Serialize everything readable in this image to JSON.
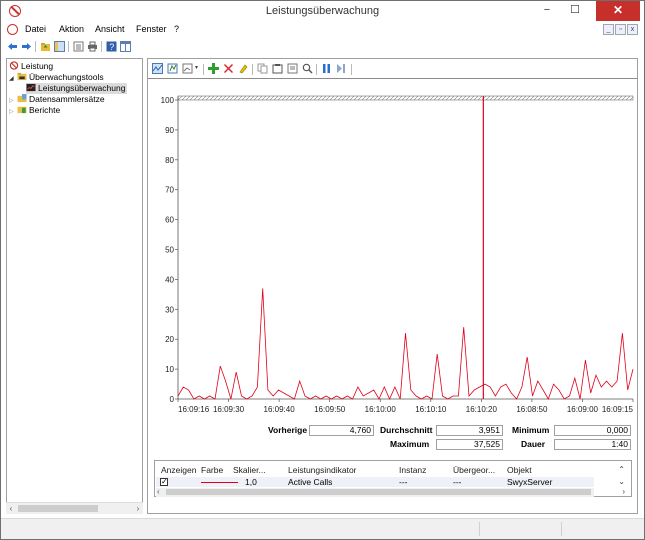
{
  "window": {
    "title": "Leistungsüberwachung"
  },
  "menubar": {
    "items": [
      "Datei",
      "Aktion",
      "Ansicht",
      "Fenster",
      "?"
    ]
  },
  "tree": {
    "items": [
      {
        "label": "Leistung",
        "level": 0,
        "expander": ""
      },
      {
        "label": "Überwachungstools",
        "level": 1,
        "expander": "◢"
      },
      {
        "label": "Leistungsüberwachung",
        "level": 2,
        "expander": ""
      },
      {
        "label": "Datensammlersätze",
        "level": 1,
        "expander": "▷"
      },
      {
        "label": "Berichte",
        "level": 1,
        "expander": "▷"
      }
    ]
  },
  "chart_data": {
    "type": "line",
    "ylim": [
      0,
      100
    ],
    "y_ticks": [
      "100",
      "90",
      "80",
      "70",
      "60",
      "50",
      "40",
      "30",
      "20",
      "10",
      "0"
    ],
    "x_tick_labels": [
      "16:09:16",
      "16:09:30",
      "16:09:40",
      "16:09:50",
      "16:10:00",
      "16:10:10",
      "16:10:20",
      "16:08:50",
      "16:09:00",
      "16:09:15"
    ],
    "current_time_marker": "16:10:20",
    "series": [
      {
        "name": "Active Calls",
        "color": "#e0001a",
        "values": [
          1,
          4,
          3,
          0,
          1,
          0,
          1,
          0,
          11,
          6,
          0,
          9,
          1,
          0,
          1,
          4,
          37,
          3,
          1,
          3,
          2,
          1,
          0,
          6,
          1,
          0,
          1,
          0,
          1,
          0,
          1,
          0,
          1,
          0,
          4,
          1,
          2,
          3,
          0,
          4,
          0,
          4,
          0,
          22,
          3,
          1,
          0,
          1,
          0,
          15,
          1,
          0,
          1,
          1,
          24,
          1,
          3,
          4,
          5,
          4,
          1,
          4,
          5,
          2,
          0,
          4,
          14,
          1,
          6,
          3,
          0,
          5,
          3,
          0,
          1,
          7,
          0,
          13,
          2,
          8,
          4,
          6,
          4,
          6,
          22,
          3,
          10
        ]
      }
    ]
  },
  "stats": {
    "vorherige_label": "Vorherige",
    "vorherige_value": "4,760",
    "durchschnitt_label": "Durchschnitt",
    "durchschnitt_value": "3,951",
    "minimum_label": "Minimum",
    "minimum_value": "0,000",
    "maximum_label": "Maximum",
    "maximum_value": "37,525",
    "dauer_label": "Dauer",
    "dauer_value": "1:40"
  },
  "legend": {
    "headers": [
      "Anzeigen",
      "Farbe",
      "Skalier...",
      "Leistungsindikator",
      "Instanz",
      "Übergeor...",
      "Objekt"
    ],
    "row": {
      "checked": true,
      "scale": "1,0",
      "counter": "Active Calls",
      "instance": "---",
      "parent": "---",
      "object": "SwyxServer",
      "color": "#e0001a"
    }
  }
}
